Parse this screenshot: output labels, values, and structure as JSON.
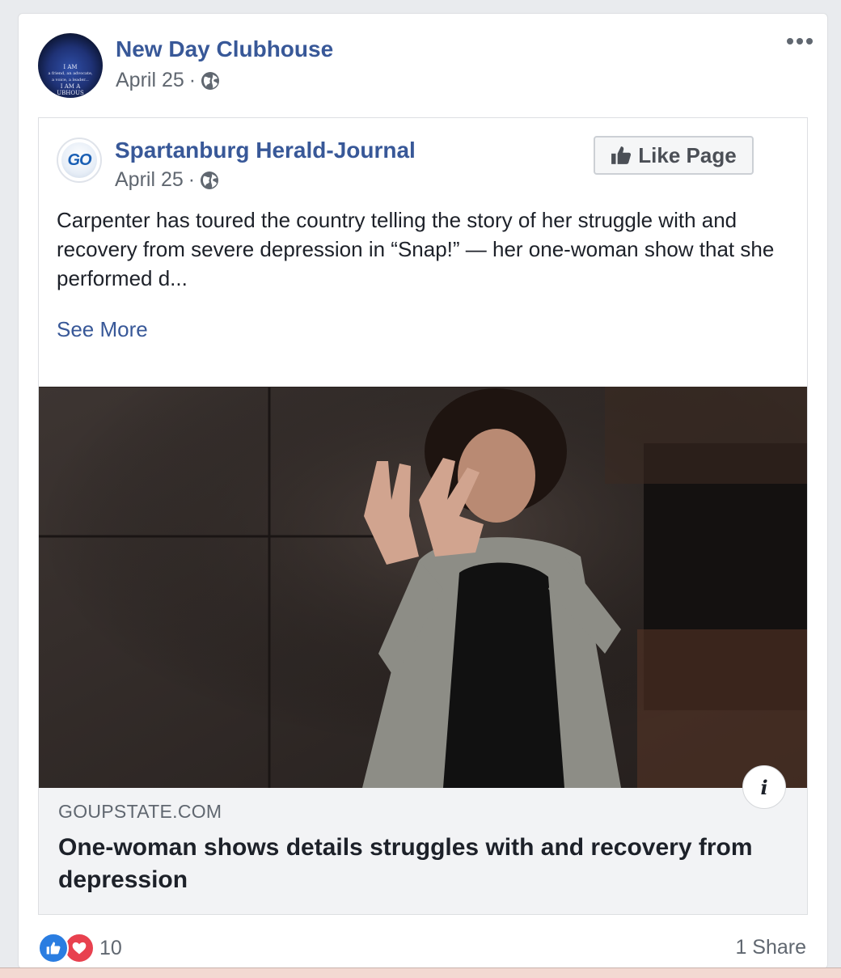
{
  "post": {
    "author": "New Day Clubhouse",
    "date": "April 25",
    "separator": "·",
    "avatar_text": [
      "I AM",
      "a friend, an advocate,",
      "a voice, a leader...",
      "I AM A",
      "UBHOUS"
    ],
    "more_icon": "ellipsis-icon",
    "privacy_icon": "globe-icon"
  },
  "shared": {
    "source": "Spartanburg Herald-Journal",
    "source_logo_text": "GO",
    "date": "April 25",
    "separator": "·",
    "like_page_label": "Like Page",
    "text": "Carpenter has toured the country telling the story of her struggle with and recovery from severe depression in “Snap!” — her one-woman show that she performed d...",
    "see_more": "See More",
    "link": {
      "domain": "GOUPSTATE.COM",
      "headline": "One-woman shows details struggles with and recovery from depression",
      "info_icon": "i"
    }
  },
  "footer": {
    "reaction_count": "10",
    "share_count": "1 Share",
    "reaction_icons": [
      "like-icon",
      "love-icon"
    ]
  },
  "colors": {
    "link_blue": "#385898",
    "text_dark": "#1d2129",
    "meta_gray": "#606770",
    "like_blue": "#2a7de1",
    "love_red": "#e8414f"
  }
}
